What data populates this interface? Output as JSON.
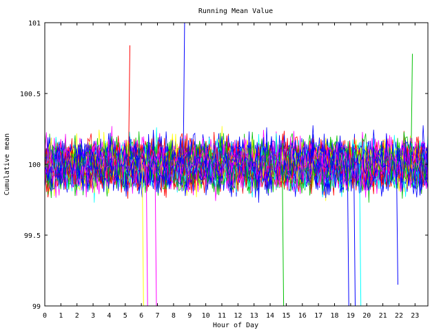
{
  "chart_data": {
    "type": "line",
    "title": "Running Mean Value",
    "xlabel": "Hour of Day",
    "ylabel": "Cumulative mean",
    "xlim": [
      0,
      23.8
    ],
    "ylim": [
      99,
      101
    ],
    "xticks": [
      "0",
      "1",
      "2",
      "3",
      "4",
      "5",
      "6",
      "7",
      "8",
      "9",
      "10",
      "11",
      "12",
      "13",
      "14",
      "15",
      "16",
      "17",
      "18",
      "19",
      "20",
      "21",
      "22",
      "23"
    ],
    "yticks": [
      "99",
      "99.5",
      "100",
      "100.5",
      "101"
    ],
    "grid": false,
    "legend": "none",
    "series_colors": [
      "#ff0000",
      "#00c000",
      "#0000ff",
      "#ff00ff",
      "#00ffff",
      "#ffff00",
      "#0000ff",
      "#ff0000",
      "#0000ff",
      "#00c000",
      "#ff00ff",
      "#0000ff"
    ],
    "series_center": 100.0,
    "series_spread": 0.22,
    "notable_excursions": [
      {
        "x": 5.2,
        "y": 100.84
      },
      {
        "x": 6.05,
        "y": 99.0
      },
      {
        "x": 6.3,
        "y": 99.0
      },
      {
        "x": 6.85,
        "y": 99.0
      },
      {
        "x": 8.6,
        "y": 101.0
      },
      {
        "x": 14.75,
        "y": 99.0
      },
      {
        "x": 18.8,
        "y": 99.0
      },
      {
        "x": 19.2,
        "y": 99.0
      },
      {
        "x": 19.55,
        "y": 99.0
      },
      {
        "x": 22.75,
        "y": 100.78
      },
      {
        "x": 21.85,
        "y": 99.15
      }
    ]
  }
}
